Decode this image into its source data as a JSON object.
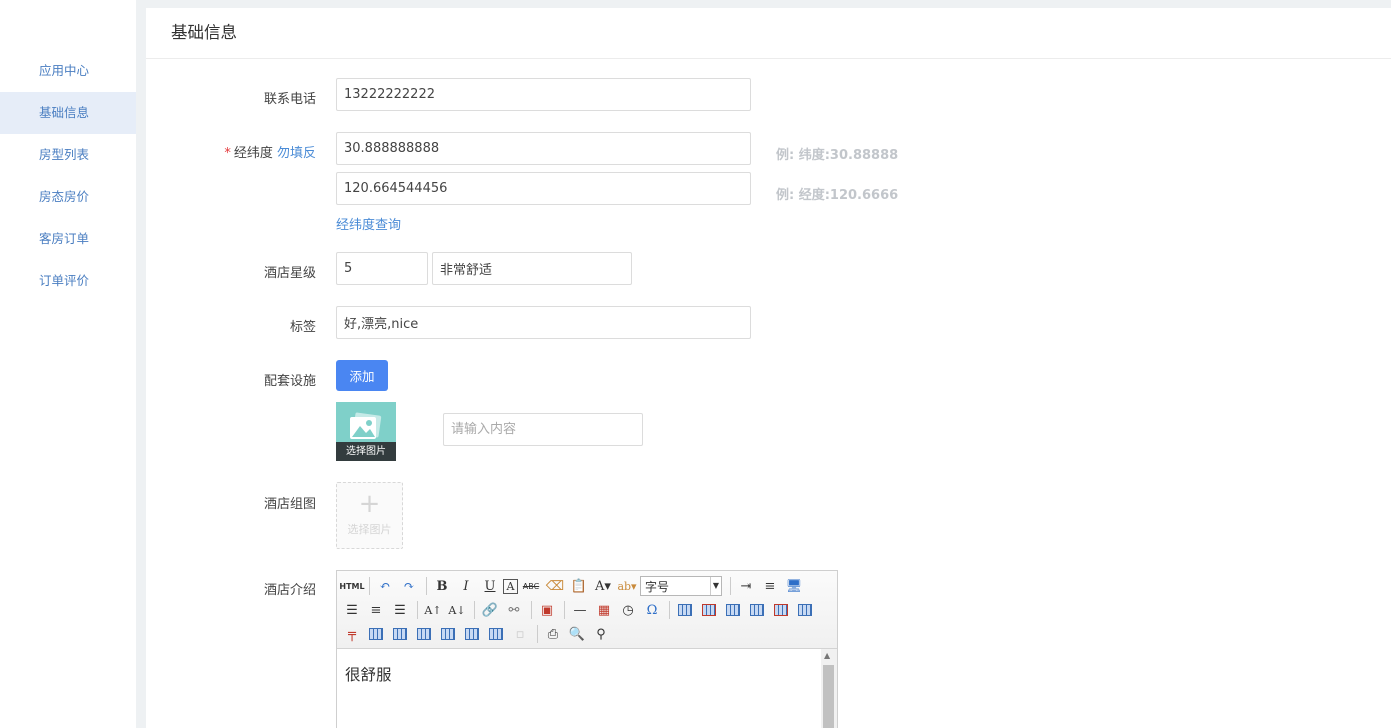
{
  "sidebar": {
    "items": [
      {
        "label": "应用中心"
      },
      {
        "label": "基础信息"
      },
      {
        "label": "房型列表"
      },
      {
        "label": "房态房价"
      },
      {
        "label": "客房订单"
      },
      {
        "label": "订单评价"
      }
    ],
    "active_index": 1
  },
  "page": {
    "title": "基础信息"
  },
  "form": {
    "phone": {
      "label": "联系电话",
      "value": "13222222222"
    },
    "latlng": {
      "required_mark": "*",
      "label": "经纬度",
      "warn": "勿填反",
      "lat_value": "30.888888888",
      "lng_value": "120.664544456",
      "lat_hint": "例: 纬度:30.88888",
      "lng_hint": "例: 经度:120.6666",
      "query_link": "经纬度查询"
    },
    "star": {
      "label": "酒店星级",
      "value": "5",
      "desc": "非常舒适"
    },
    "tags": {
      "label": "标签",
      "value": "好,漂亮,nice"
    },
    "facility": {
      "label": "配套设施",
      "add_button": "添加",
      "pick_image_caption": "选择图片",
      "content_placeholder": "请输入内容"
    },
    "gallery": {
      "label": "酒店组图",
      "add_plus": "+",
      "add_text": "选择图片"
    },
    "intro": {
      "label": "酒店介绍",
      "font_size_select": "字号",
      "html_button": "HTML",
      "content": "很舒服"
    }
  }
}
